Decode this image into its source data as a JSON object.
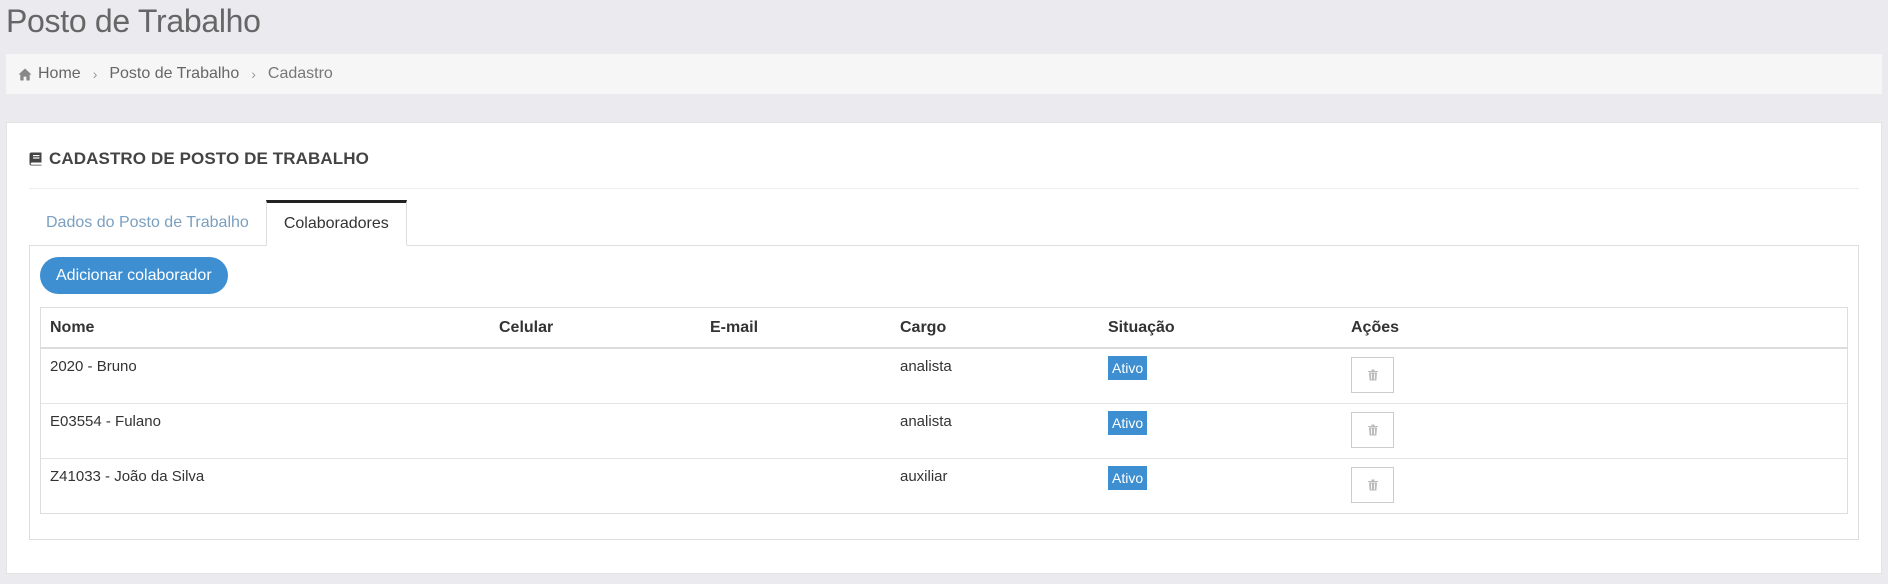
{
  "page": {
    "title": "Posto de Trabalho"
  },
  "breadcrumb": {
    "home": "Home",
    "section": "Posto de Trabalho",
    "current": "Cadastro",
    "separator": "›"
  },
  "card": {
    "title": "CADASTRO DE POSTO DE TRABALHO"
  },
  "tabs": [
    {
      "label": "Dados do Posto de Trabalho",
      "active": false
    },
    {
      "label": "Colaboradores",
      "active": true
    }
  ],
  "toolbar": {
    "add_label": "Adicionar colaborador"
  },
  "table": {
    "columns": [
      "Nome",
      "Celular",
      "E-mail",
      "Cargo",
      "Situação",
      "Ações"
    ],
    "rows": [
      {
        "nome": "2020 - Bruno",
        "celular": "",
        "email": "",
        "cargo": "analista",
        "situacao": "Ativo"
      },
      {
        "nome": "E03554 - Fulano",
        "celular": "",
        "email": "",
        "cargo": "analista",
        "situacao": "Ativo"
      },
      {
        "nome": "Z41033 - João da Silva",
        "celular": "",
        "email": "",
        "cargo": "auxiliar",
        "situacao": "Ativo"
      }
    ]
  },
  "colors": {
    "accent": "#3d8fd1",
    "tab_inactive": "#7a9fc0",
    "background": "#ebebef"
  },
  "icons": {
    "breadcrumb_home": "home-icon",
    "card_title": "book-icon",
    "row_action": "trash-icon"
  }
}
